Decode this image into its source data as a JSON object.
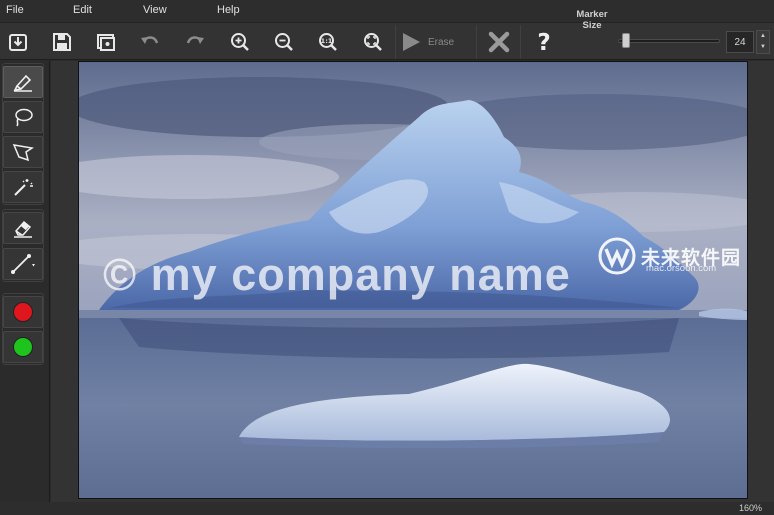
{
  "menu": [
    "File",
    "Edit",
    "View",
    "Help"
  ],
  "toolbar": {
    "icons": [
      "import-icon",
      "save-icon",
      "preview-icon",
      "undo-icon",
      "redo-icon",
      "zoom-in-icon",
      "zoom-out-icon",
      "zoom-actual-icon",
      "zoom-fit-icon"
    ],
    "erase_label": "Erase",
    "marker_size_label_line1": "Marker",
    "marker_size_label_line2": "Size",
    "marker_size_value": "24",
    "marker_size_slider_fraction": 0.04
  },
  "tools": [
    "marker-tool",
    "lasso-tool",
    "polygon-lasso-tool",
    "magic-wand-tool",
    "eraser-tool",
    "line-tool"
  ],
  "colors": {
    "marker_red": "#e0161e",
    "marker_green": "#1ec31e",
    "background": "#2b2b2b"
  },
  "canvas": {
    "watermark_text": "© my company name",
    "logo_watermark_text": "未来软件园",
    "logo_watermark_url": "mac.orsoon.com"
  },
  "status": {
    "zoom": "160%"
  }
}
